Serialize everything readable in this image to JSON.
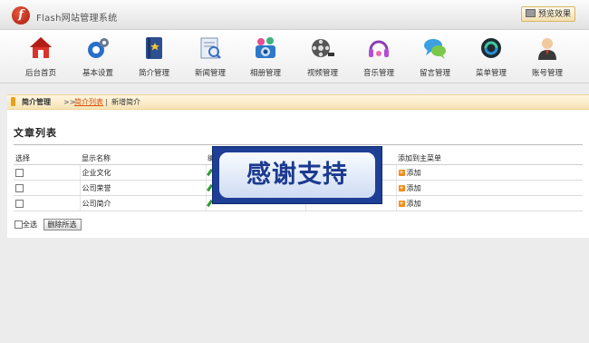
{
  "header": {
    "logo_letter": "f",
    "title": "Flash网站管理系统",
    "preview_label": "预览效果"
  },
  "toolbar": {
    "items": [
      {
        "label": "后台首页",
        "icon": "home-icon"
      },
      {
        "label": "基本设置",
        "icon": "gear-icon"
      },
      {
        "label": "简介管理",
        "icon": "book-icon"
      },
      {
        "label": "新闻管理",
        "icon": "news-icon"
      },
      {
        "label": "相册管理",
        "icon": "camera-icon"
      },
      {
        "label": "视频管理",
        "icon": "film-reel-icon"
      },
      {
        "label": "音乐管理",
        "icon": "music-icon"
      },
      {
        "label": "留言管理",
        "icon": "chat-bubble-icon"
      },
      {
        "label": "菜单管理",
        "icon": "menu-icon"
      },
      {
        "label": "账号管理",
        "icon": "user-icon"
      }
    ]
  },
  "breadcrumb": {
    "section": "简介管理",
    "separator": ">>",
    "current": "简介列表",
    "divider": "|",
    "action": "新增简介"
  },
  "content": {
    "title": "文章列表",
    "columns": [
      "选择",
      "显示名称",
      "编",
      "",
      "添加到主菜单"
    ],
    "rows": [
      {
        "name": "企业文化",
        "add": "添加"
      },
      {
        "name": "公司荣誉",
        "add": "添加"
      },
      {
        "name": "公司简介",
        "add": "添加"
      }
    ],
    "select_all": "全选",
    "delete_selected": "删除所选"
  },
  "overlay": {
    "text": "感谢支持"
  }
}
